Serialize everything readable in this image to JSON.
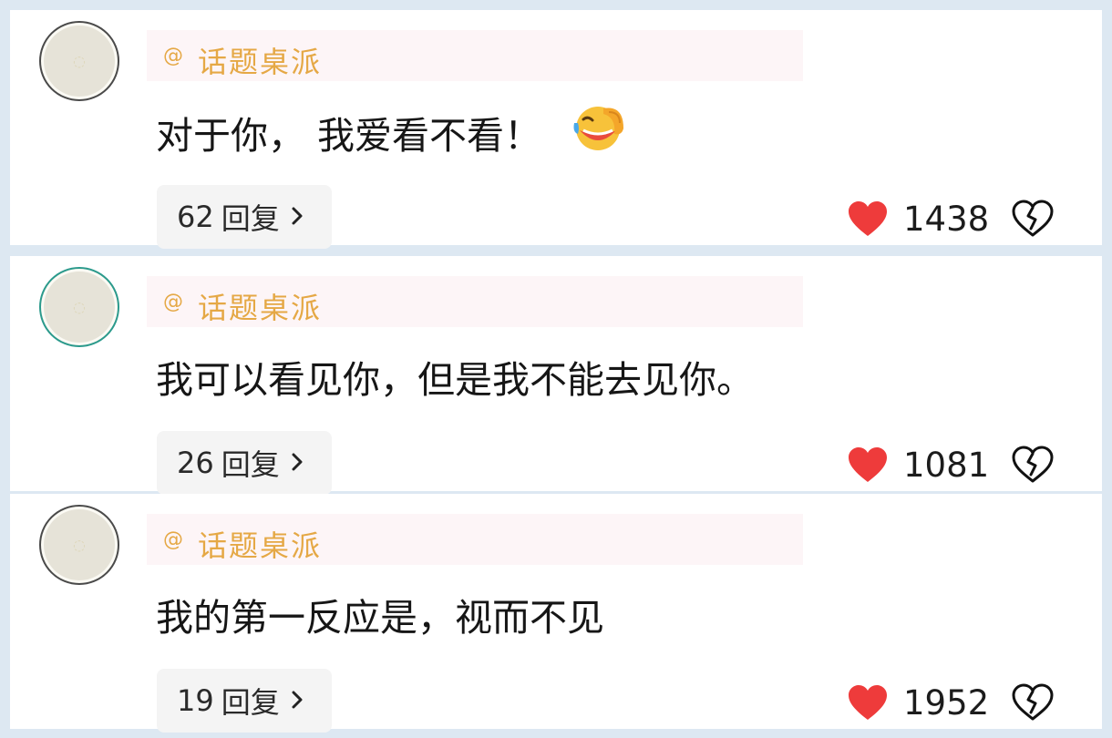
{
  "colors": {
    "page_background": "#dde8f2",
    "username": "#e5a845",
    "username_bar": "#fdf5f7",
    "like_heart": "#ee3b3b",
    "reply_button_bg": "#f4f4f4"
  },
  "comments": [
    {
      "username_prefix": "@",
      "username": "话题桌派",
      "text": "对于你， 我爱看不看！",
      "emoji": "laughing-crying-face-icon",
      "reply_count": "62",
      "reply_label": "回复",
      "like_count": "1438"
    },
    {
      "username_prefix": "@",
      "username": "话题桌派",
      "text": "我可以看见你，但是我不能去见你。",
      "emoji": "",
      "reply_count": "26",
      "reply_label": "回复",
      "like_count": "1081"
    },
    {
      "username_prefix": "@",
      "username": "话题桌派",
      "text": "我的第一反应是，视而不见",
      "emoji": "",
      "reply_count": "19",
      "reply_label": "回复",
      "like_count": "1952"
    }
  ]
}
